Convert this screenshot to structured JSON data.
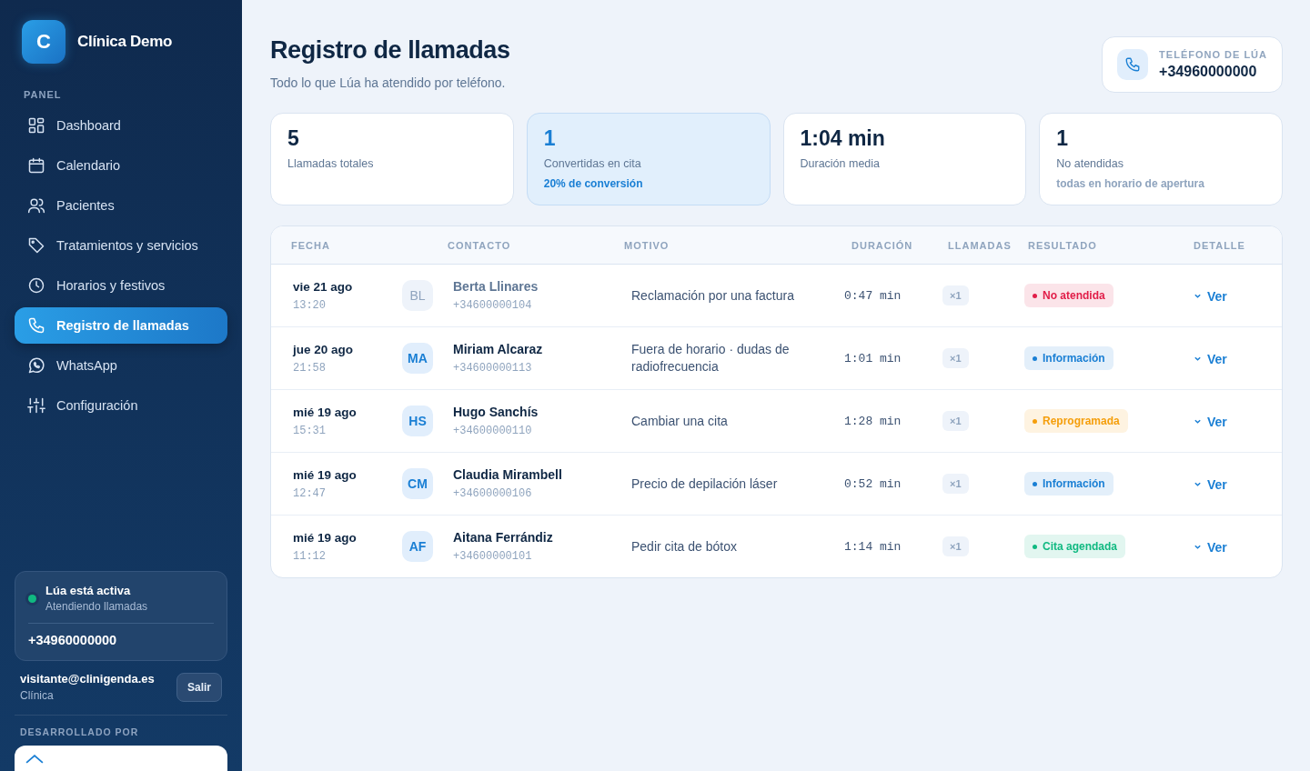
{
  "brand": {
    "logo": "C",
    "name": "Clínica Demo"
  },
  "sidebar": {
    "section": "PANEL",
    "items": [
      {
        "label": "Dashboard",
        "selected": false
      },
      {
        "label": "Calendario",
        "selected": false
      },
      {
        "label": "Pacientes",
        "selected": false
      },
      {
        "label": "Tratamientos y servicios",
        "selected": false
      },
      {
        "label": "Horarios y festivos",
        "selected": false
      },
      {
        "label": "Registro de llamadas",
        "selected": true
      },
      {
        "label": "WhatsApp",
        "selected": false
      },
      {
        "label": "Configuración",
        "selected": false
      }
    ],
    "status": {
      "title": "Lúa está activa",
      "subtitle": "Atendiendo llamadas",
      "active": true,
      "phone": "+34960000000"
    },
    "user": {
      "email": "visitante@clinigenda.es",
      "role": "Clínica",
      "logout": "Salir"
    },
    "developed_by": "DESARROLLADO POR"
  },
  "header": {
    "title": "Registro de llamadas",
    "subtitle": "Todo lo que Lúa ha atendido por teléfono.",
    "phone_label": "TELÉFONO DE LÚA",
    "phone": "+34960000000"
  },
  "stats": [
    {
      "value": "5",
      "label": "Llamadas totales",
      "highlighted": false
    },
    {
      "value": "1",
      "label": "Convertidas en cita",
      "note": "20% de conversión",
      "highlighted": true
    },
    {
      "value": "1:04 min",
      "label": "Duración media",
      "highlighted": false
    },
    {
      "value": "1",
      "label": "No atendidas",
      "note": "todas en horario de apertura",
      "highlighted": false
    }
  ],
  "table": {
    "columns": [
      "FECHA",
      "CONTACTO",
      "MOTIVO",
      "DURACIÓN",
      "LLAMADAS",
      "RESULTADO",
      "DETALLE"
    ],
    "rows": [
      {
        "date": "vie 21 ago",
        "time": "13:20",
        "initials": "BL",
        "name": "Berta Llinares",
        "phone": "+34600000104",
        "reason": "Reclamación por una factura",
        "duration": "0:47 min",
        "calls": "×1",
        "result": "No atendida",
        "color": "#e11d48",
        "missed": true,
        "action": "Ver"
      },
      {
        "date": "jue 20 ago",
        "time": "21:58",
        "initials": "MA",
        "name": "Miriam Alcaraz",
        "phone": "+34600000113",
        "reason": "Fuera de horario · dudas de radiofrecuencia",
        "duration": "1:01 min",
        "calls": "×1",
        "result": "Información",
        "color": "#1a7fd4",
        "missed": false,
        "action": "Ver"
      },
      {
        "date": "mié 19 ago",
        "time": "15:31",
        "initials": "HS",
        "name": "Hugo Sanchís",
        "phone": "+34600000110",
        "reason": "Cambiar una cita",
        "duration": "1:28 min",
        "calls": "×1",
        "result": "Reprogramada",
        "color": "#f59e0b",
        "missed": false,
        "action": "Ver"
      },
      {
        "date": "mié 19 ago",
        "time": "12:47",
        "initials": "CM",
        "name": "Claudia Mirambell",
        "phone": "+34600000106",
        "reason": "Precio de depilación láser",
        "duration": "0:52 min",
        "calls": "×1",
        "result": "Información",
        "color": "#1a7fd4",
        "missed": false,
        "action": "Ver"
      },
      {
        "date": "mié 19 ago",
        "time": "11:12",
        "initials": "AF",
        "name": "Aitana Ferrándiz",
        "phone": "+34600000101",
        "reason": "Pedir cita de bótox",
        "duration": "1:14 min",
        "calls": "×1",
        "result": "Cita agendada",
        "color": "#10b981",
        "missed": false,
        "action": "Ver"
      }
    ]
  }
}
